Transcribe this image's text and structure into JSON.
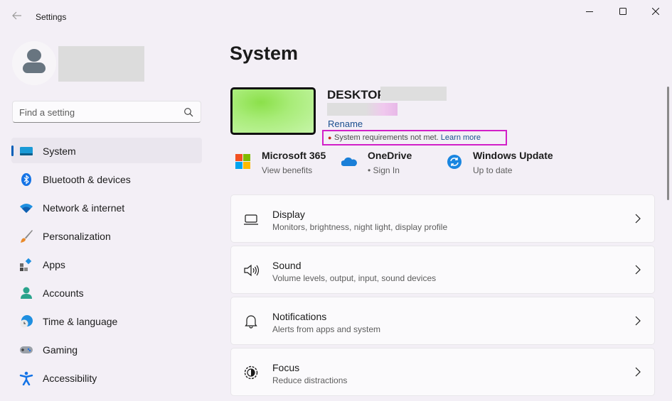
{
  "window": {
    "title": "Settings",
    "controls": {
      "minimize": "minimize",
      "maximize": "maximize",
      "close": "close"
    }
  },
  "search": {
    "placeholder": "Find a setting",
    "value": ""
  },
  "sidebar": {
    "items": [
      {
        "label": "System",
        "icon": "system-icon",
        "active": true
      },
      {
        "label": "Bluetooth & devices",
        "icon": "bluetooth-icon"
      },
      {
        "label": "Network & internet",
        "icon": "wifi-icon"
      },
      {
        "label": "Personalization",
        "icon": "brush-icon"
      },
      {
        "label": "Apps",
        "icon": "apps-icon"
      },
      {
        "label": "Accounts",
        "icon": "accounts-icon"
      },
      {
        "label": "Time & language",
        "icon": "time-language-icon"
      },
      {
        "label": "Gaming",
        "icon": "gaming-icon"
      },
      {
        "label": "Accessibility",
        "icon": "accessibility-icon"
      }
    ]
  },
  "main": {
    "title": "System",
    "device": {
      "name_prefix": "DESKTOP",
      "rename_label": "Rename",
      "requirements_text": "System requirements not met.",
      "learn_more_label": "Learn more"
    },
    "quick_links": [
      {
        "title": "Microsoft 365",
        "subtitle": "View benefits",
        "icon": "microsoft-365-icon"
      },
      {
        "title": "OneDrive",
        "subtitle": "• Sign In",
        "icon": "onedrive-icon"
      },
      {
        "title": "Windows Update",
        "subtitle": "Up to date",
        "icon": "windows-update-icon"
      }
    ],
    "cards": [
      {
        "title": "Display",
        "subtitle": "Monitors, brightness, night light, display profile",
        "icon": "display-icon"
      },
      {
        "title": "Sound",
        "subtitle": "Volume levels, output, input, sound devices",
        "icon": "sound-icon"
      },
      {
        "title": "Notifications",
        "subtitle": "Alerts from apps and system",
        "icon": "bell-icon"
      },
      {
        "title": "Focus",
        "subtitle": "Reduce distractions",
        "icon": "focus-icon"
      }
    ]
  },
  "colors": {
    "accent": "#005fb8",
    "link": "#1a4f8f",
    "highlight_box": "#d21fc8",
    "warning_dot": "#c42b1c"
  }
}
